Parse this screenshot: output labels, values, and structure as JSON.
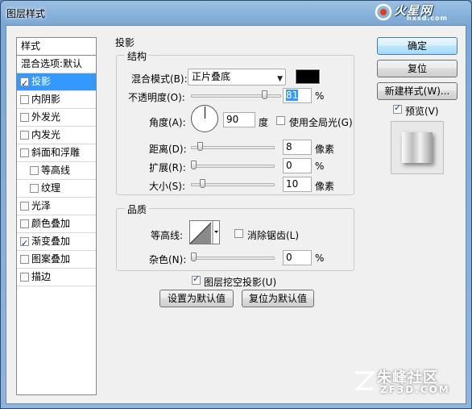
{
  "window": {
    "title": "图层样式",
    "logo_text": "火星网",
    "logo_sub": "hxsd.com"
  },
  "style_list": {
    "header": "样式",
    "blend_default": "混合选项:默认",
    "items": [
      {
        "label": "投影",
        "checked": true,
        "selected": true
      },
      {
        "label": "内阴影",
        "checked": false
      },
      {
        "label": "外发光",
        "checked": false
      },
      {
        "label": "内发光",
        "checked": false
      },
      {
        "label": "斜面和浮雕",
        "checked": false
      },
      {
        "label": "等高线",
        "checked": false,
        "sub": true
      },
      {
        "label": "纹理",
        "checked": false,
        "sub": true
      },
      {
        "label": "光泽",
        "checked": false
      },
      {
        "label": "颜色叠加",
        "checked": false
      },
      {
        "label": "渐变叠加",
        "checked": true
      },
      {
        "label": "图案叠加",
        "checked": false
      },
      {
        "label": "描边",
        "checked": false
      }
    ]
  },
  "drop_shadow": {
    "section_title": "投影",
    "structure_title": "结构",
    "blend_mode_label": "混合模式(B):",
    "blend_mode_value": "正片叠底",
    "shadow_color": "#000000",
    "opacity_label": "不透明度(O):",
    "opacity_value": "81",
    "opacity_unit": "%",
    "opacity_fraction": 0.81,
    "angle_label": "角度(A):",
    "angle_value": "90",
    "angle_unit": "度",
    "global_light_label": "使用全局光(G)",
    "global_light_checked": false,
    "distance_label": "距离(D):",
    "distance_value": "8",
    "distance_unit": "像素",
    "spread_label": "扩展(R):",
    "spread_value": "0",
    "spread_unit": "%",
    "size_label": "大小(S):",
    "size_value": "10",
    "size_unit": "像素",
    "quality_title": "品质",
    "contour_label": "等高线:",
    "anti_alias_label": "消除锯齿(L)",
    "anti_alias_checked": false,
    "noise_label": "杂色(N):",
    "noise_value": "0",
    "noise_unit": "%",
    "knockout_label": "图层挖空投影(U)",
    "knockout_checked": true,
    "set_default_label": "设置为默认值",
    "reset_default_label": "复位为默认值"
  },
  "buttons": {
    "ok": "确定",
    "reset": "复位",
    "new_style": "新建样式(W)...",
    "preview_label": "预览(V)",
    "preview_checked": true
  },
  "watermark": {
    "text": "朱峰社区",
    "sub": "ZF3D.COM"
  }
}
